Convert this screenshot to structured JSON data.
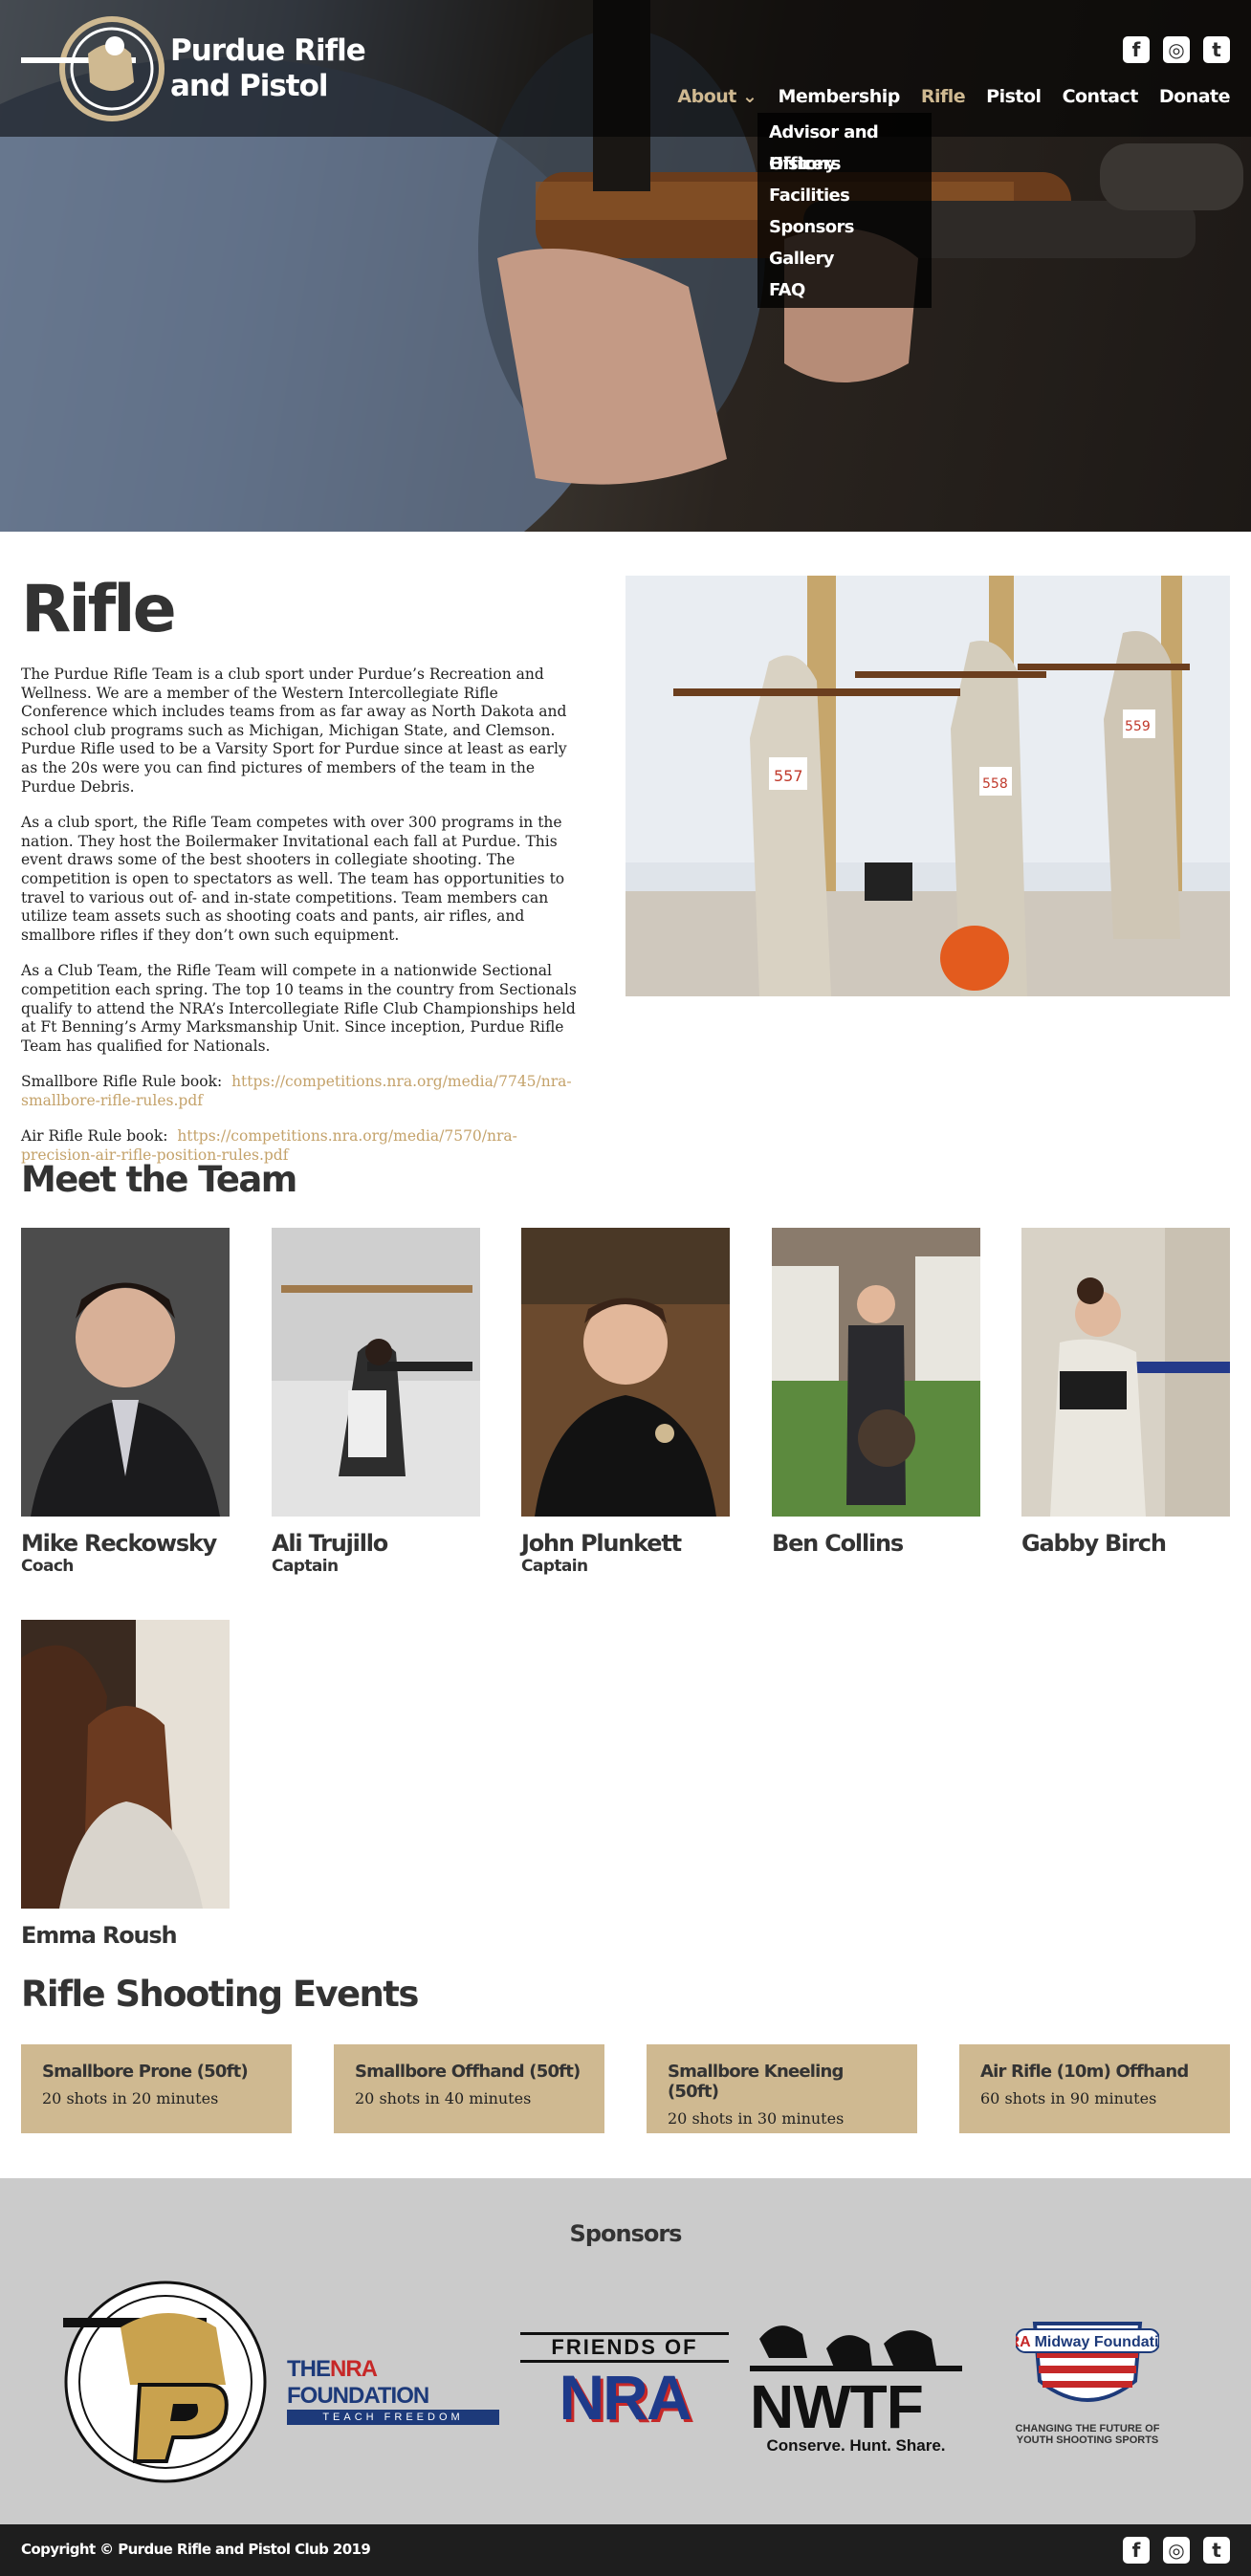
{
  "header": {
    "logo_line1": "Purdue Rifle",
    "logo_line2": "and Pistol",
    "social": [
      {
        "icon": "facebook-icon",
        "glyph": "f"
      },
      {
        "icon": "instagram-icon",
        "glyph": "◎"
      },
      {
        "icon": "twitter-icon",
        "glyph": "t"
      }
    ],
    "nav": [
      {
        "label": "About",
        "icon": "chevron-down-icon",
        "active": true
      },
      {
        "label": "Membership",
        "active": false
      },
      {
        "label": "Rifle",
        "active": true
      },
      {
        "label": "Pistol",
        "active": false
      },
      {
        "label": "Contact",
        "active": false
      },
      {
        "label": "Donate",
        "active": false
      }
    ],
    "about_dropdown": [
      "Advisor and Officers",
      "History",
      "Facilities",
      "Sponsors",
      "Gallery",
      "FAQ"
    ]
  },
  "main": {
    "title": "Rifle",
    "paragraphs": [
      "The Purdue Rifle Team is a club sport under Purdue’s Recreation and Wellness.  We are a member of the Western Intercollegiate Rifle Conference which includes teams from as far away as North Dakota and school club programs such as Michigan, Michigan State, and Clemson.  Purdue Rifle used to be a Varsity Sport for Purdue since at least as early as the 20s were you can find pictures of members of the team in the Purdue Debris.",
      "As a club sport, the Rifle Team competes with over 300 programs in the nation.  They host the Boilermaker Invitational each fall at Purdue.  This event draws some of the best shooters in collegiate shooting.  The competition is open to spectators as well.  The team has opportunities to travel to various out of- and in-state competitions.  Team members can utilize team assets such as shooting coats and pants, air rifles, and smallbore rifles if they don’t own such equipment.",
      "As a Club Team, the Rifle Team will compete in a nationwide Sectional competition each spring.  The top 10 teams in the country from Sectionals qualify to attend the NRA’s Intercollegiate Rifle Club Championships held at Ft Benning’s Army Marksmanship Unit.  Since inception, Purdue Rifle Team has qualified for Nationals."
    ],
    "smallbore_label": "Smallbore Rifle Rule book:",
    "smallbore_link": "https://competitions.nra.org/media/7745/nra-smallbore-rifle-rules.pdf",
    "air_label": "Air Rifle Rule book:",
    "air_link": "https://competitions.nra.org/media/7570/nra-precision-air-rifle-position-rules.pdf"
  },
  "team": {
    "title": "Meet the Team",
    "members": [
      {
        "name": "Mike Reckowsky",
        "role": "Coach"
      },
      {
        "name": "Ali Trujillo",
        "role": "Captain"
      },
      {
        "name": "John Plunkett",
        "role": "Captain"
      },
      {
        "name": "Ben Collins",
        "role": ""
      },
      {
        "name": "Gabby Birch",
        "role": ""
      },
      {
        "name": "Emma Roush",
        "role": ""
      }
    ]
  },
  "events": {
    "title": "Rifle Shooting Events",
    "items": [
      {
        "name": "Smallbore Prone (50ft)",
        "desc": "20 shots in 20 minutes"
      },
      {
        "name": "Smallbore Offhand (50ft)",
        "desc": "20 shots in 40 minutes"
      },
      {
        "name": "Smallbore Kneeling (50ft)",
        "desc": "20 shots in 30 minutes"
      },
      {
        "name": "Air Rifle (10m) Offhand",
        "desc": "60 shots in 90 minutes"
      }
    ]
  },
  "sponsors": {
    "title": "Sponsors",
    "nra_foundation_the": "THE",
    "nra_foundation_nra": "NRA",
    "nra_foundation_word": "FOUNDATION",
    "nra_foundation_tag": "TEACH FREEDOM",
    "friends_of": "FRIENDS OF",
    "friends_nra": "NRA",
    "nwtf": "NWTF",
    "nwtf_tag": "Conserve. Hunt. Share.",
    "midway_nra": "NRA",
    "midway_name": "Midway",
    "midway_word": "Foundation",
    "midway_tag1": "CHANGING THE FUTURE OF",
    "midway_tag2": "YOUTH SHOOTING SPORTS"
  },
  "footer": {
    "copyright": "Copyright © Purdue Rifle and Pistol Club 2019"
  },
  "colors": {
    "gold": "#cfb991",
    "link": "#c4a26a",
    "dark": "#1e1e1e",
    "sponsor_bg": "#cbcbcb"
  }
}
